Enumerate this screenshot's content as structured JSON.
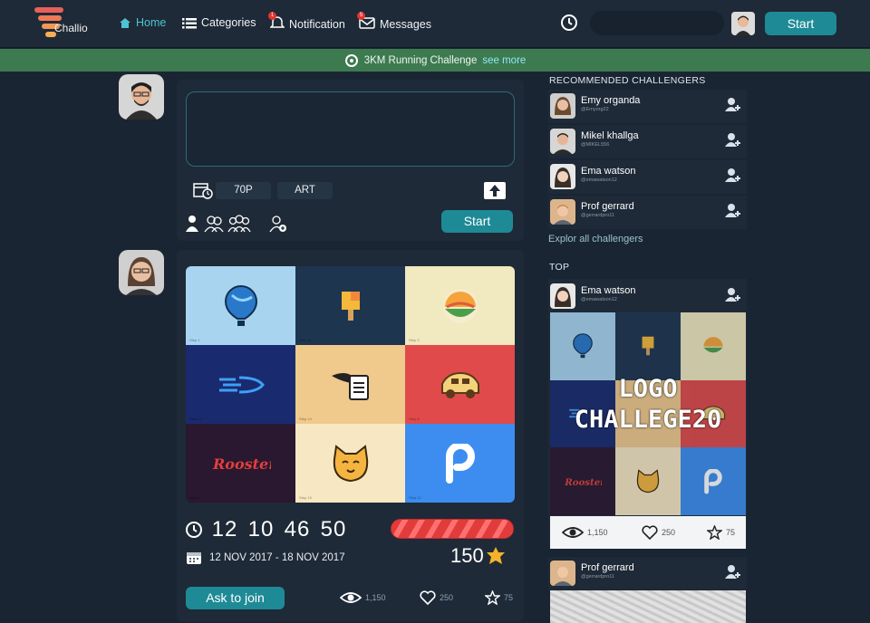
{
  "nav": {
    "logo_text": "Challio",
    "home": "Home",
    "categories": "Categories",
    "notification": "Notification",
    "notification_count": "1",
    "messages": "Messages",
    "messages_count": "5",
    "search_placeholder": "",
    "start": "Start"
  },
  "banner": {
    "text": "3KM Running Challenge",
    "link": "see more"
  },
  "composer": {
    "chip_points": "70P",
    "chip_category": "ART",
    "start": "Start"
  },
  "post": {
    "cells": [
      {
        "color": "#a9d4f0",
        "step": "Step 1"
      },
      {
        "color": "#1e3550",
        "step": "Step 11"
      },
      {
        "color": "#f1e9bf",
        "step": "Step 3"
      },
      {
        "color": "#1a2a6e",
        "step": "Step 12"
      },
      {
        "color": "#f0c98c",
        "step": "Step 14"
      },
      {
        "color": "#e04a4a",
        "step": "Step 8"
      },
      {
        "color": "#2a1730",
        "step": "Step 9"
      },
      {
        "color": "#f7e8c3",
        "step": "Step 19"
      },
      {
        "color": "#3d8df0",
        "step": "Step 12"
      }
    ],
    "timer": [
      "12",
      "10",
      "46",
      "50"
    ],
    "dates": "12 NOV 2017 - 18 NOV 2017",
    "progress": 1.0,
    "points": "150",
    "ask": "Ask to join",
    "views": "1,150",
    "likes": "250",
    "stars": "75"
  },
  "recommended": {
    "title": "RECOMMENDED CHALLENGERS",
    "people": [
      {
        "name": "Emy organda",
        "handle": "@Emyorg22"
      },
      {
        "name": "Mikel khallga",
        "handle": "@MIKEL556"
      },
      {
        "name": "Ema watson",
        "handle": "@emawatson12"
      },
      {
        "name": "Prof gerrard",
        "handle": "@gerrardpro11"
      }
    ],
    "explore": "Explor all challengers"
  },
  "top": {
    "title": "TOP",
    "person": {
      "name": "Ema watson",
      "handle": "@emawatson12"
    },
    "overlay": [
      "LOGO",
      "CHALLEGE20"
    ],
    "views": "1,150",
    "likes": "250",
    "stars": "75",
    "next_person": {
      "name": "Prof gerrard",
      "handle": "@gerrardpro11"
    }
  },
  "colors": {
    "accent": "#1e8a96",
    "banner": "#3d7a50",
    "bg": "#1a2533",
    "card": "#1e2a37"
  }
}
